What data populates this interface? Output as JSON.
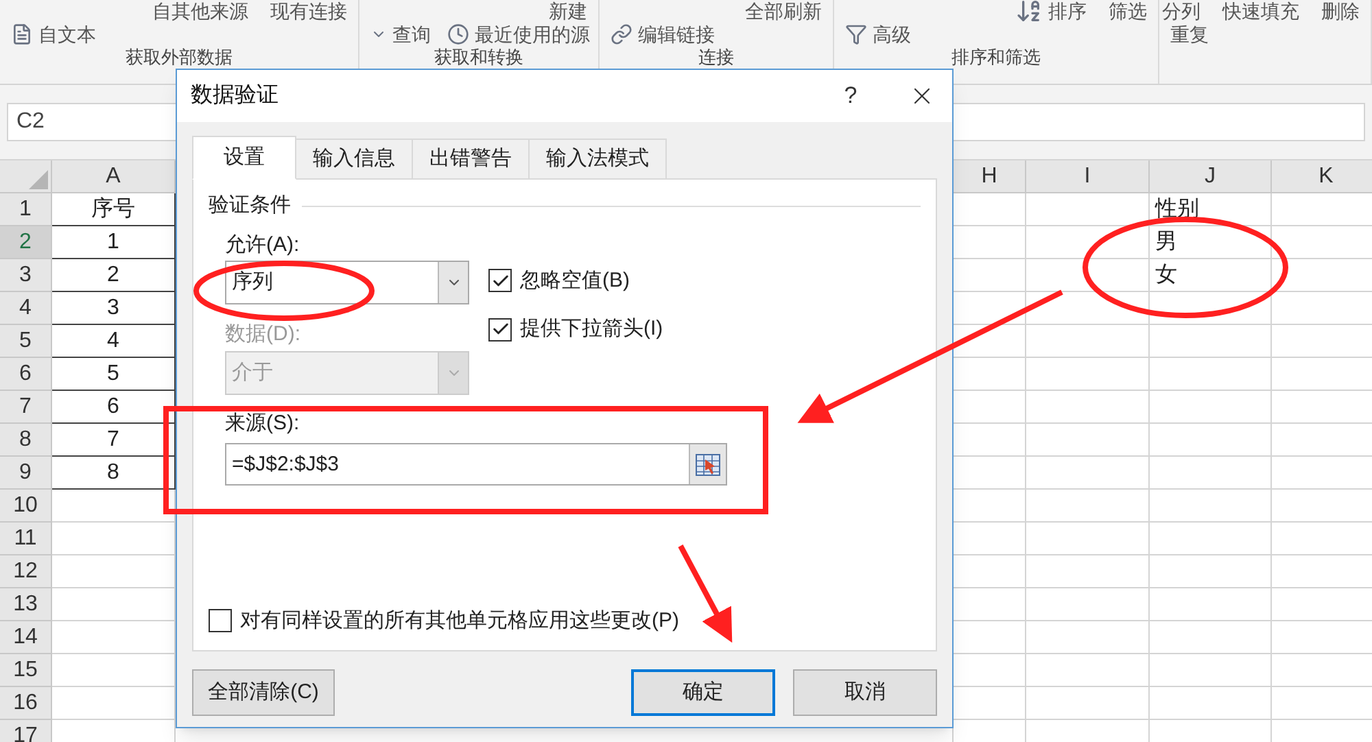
{
  "ribbon": {
    "groups": [
      {
        "label": "获取外部数据",
        "top_items": [
          {
            "label": "自其他来源"
          },
          {
            "label": "现有连接"
          }
        ],
        "bottom_items": [
          {
            "label": "自文本"
          }
        ]
      },
      {
        "label": "获取和转换",
        "top_items": [
          {
            "label": "新建"
          }
        ],
        "bottom_items": [
          {
            "label": "查询"
          },
          {
            "label": "最近使用的源"
          }
        ]
      },
      {
        "label": "连接",
        "top_items": [
          {
            "label": "全部刷新"
          }
        ],
        "bottom_items": [
          {
            "label": "编辑链接"
          }
        ]
      },
      {
        "label": "排序和筛选",
        "top_items": [
          {
            "label": "排序"
          },
          {
            "label": "筛选"
          }
        ],
        "bottom_items": [
          {
            "label": "高级"
          }
        ]
      },
      {
        "top_items": [
          {
            "label": "分列"
          },
          {
            "label": "快速填充"
          },
          {
            "label": "删除"
          }
        ],
        "bottom_items": [
          {
            "label": "重复"
          }
        ]
      }
    ]
  },
  "name_box": "C2",
  "sheet": {
    "columns": [
      "A",
      "H",
      "I",
      "J",
      "K"
    ],
    "rows": [
      {
        "number": "1",
        "selected": false,
        "a": "序号",
        "j": "性别"
      },
      {
        "number": "2",
        "selected": true,
        "a": "1",
        "j": "男"
      },
      {
        "number": "3",
        "selected": false,
        "a": "2",
        "j": "女"
      },
      {
        "number": "4",
        "selected": false,
        "a": "3"
      },
      {
        "number": "5",
        "selected": false,
        "a": "4"
      },
      {
        "number": "6",
        "selected": false,
        "a": "5"
      },
      {
        "number": "7",
        "selected": false,
        "a": "6"
      },
      {
        "number": "8",
        "selected": false,
        "a": "7"
      },
      {
        "number": "9",
        "selected": false,
        "a": "8"
      },
      {
        "number": "10",
        "selected": false
      },
      {
        "number": "11",
        "selected": false
      },
      {
        "number": "12",
        "selected": false
      },
      {
        "number": "13",
        "selected": false
      },
      {
        "number": "14",
        "selected": false
      },
      {
        "number": "15",
        "selected": false
      },
      {
        "number": "16",
        "selected": false
      },
      {
        "number": "17",
        "selected": false
      }
    ]
  },
  "dialog": {
    "title": "数据验证",
    "help": "?",
    "tabs": [
      {
        "label": "设置",
        "selected": true
      },
      {
        "label": "输入信息",
        "selected": false
      },
      {
        "label": "出错警告",
        "selected": false
      },
      {
        "label": "输入法模式",
        "selected": false
      }
    ],
    "section": "验证条件",
    "allow": {
      "label": "允许(A):",
      "value": "序列",
      "disabled": false
    },
    "data": {
      "label": "数据(D):",
      "value": "介于",
      "disabled": true
    },
    "checkboxes": [
      {
        "label": "忽略空值(B)",
        "checked": true
      },
      {
        "label": "提供下拉箭头(I)",
        "checked": true
      }
    ],
    "source": {
      "label": "来源(S):",
      "value": "=$J$2:$J$3"
    },
    "apply_all": {
      "label": "对有同样设置的所有其他单元格应用这些更改(P)",
      "checked": false
    },
    "buttons": [
      {
        "label": "全部清除(C)",
        "default": false
      },
      {
        "label": "确定",
        "default": true
      },
      {
        "label": "取消",
        "default": false
      }
    ]
  }
}
